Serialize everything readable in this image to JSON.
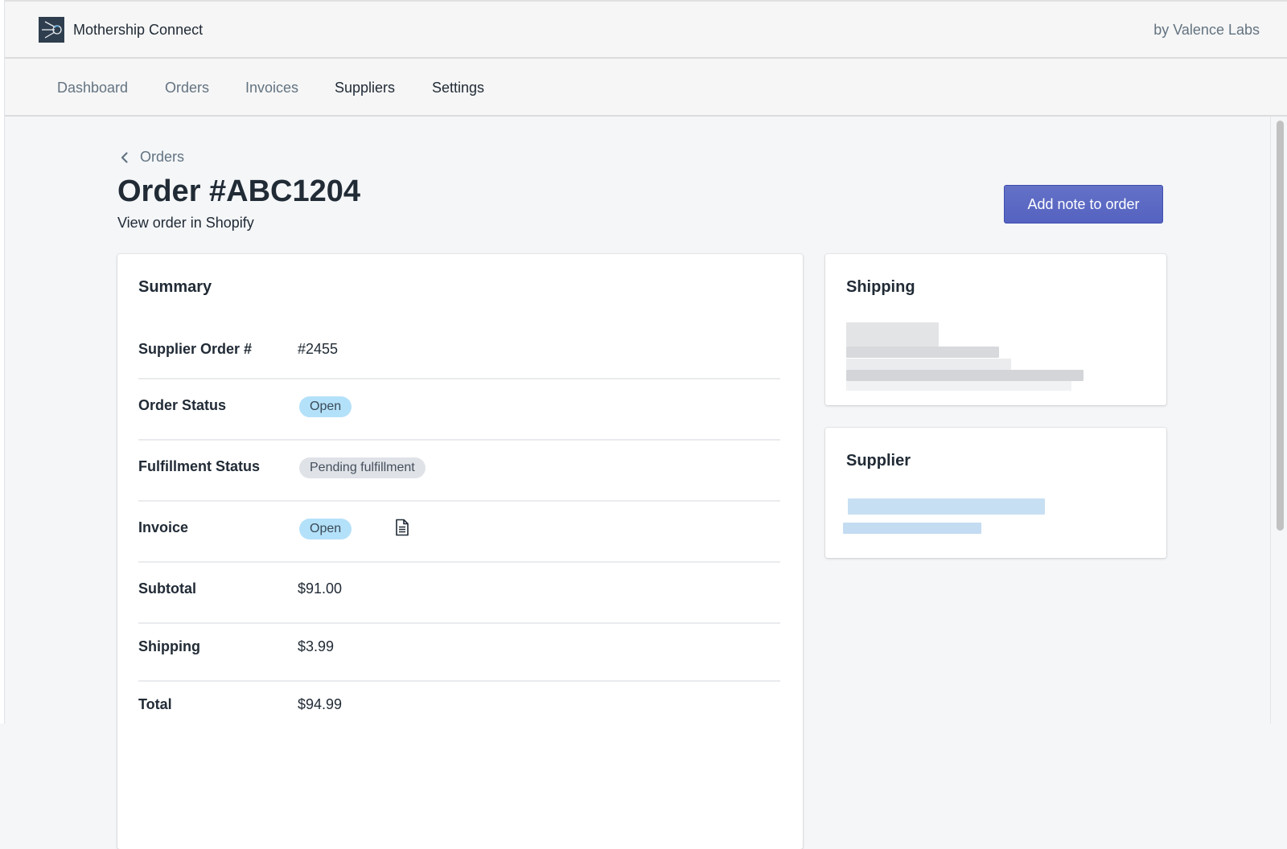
{
  "app": {
    "title": "Mothership Connect",
    "byline": "by Valence Labs",
    "logo_icon": "satellite-logo-icon"
  },
  "nav": {
    "items": [
      {
        "label": "Dashboard"
      },
      {
        "label": "Orders"
      },
      {
        "label": "Invoices"
      },
      {
        "label": "Suppliers"
      },
      {
        "label": "Settings"
      }
    ]
  },
  "page": {
    "breadcrumb": "Orders",
    "title": "Order #ABC1204",
    "shopify_link": "View order in Shopify",
    "add_note_button": "Add note to order"
  },
  "summary": {
    "heading": "Summary",
    "rows": [
      {
        "label": "Supplier Order #",
        "value": "#2455"
      },
      {
        "label": "Order Status",
        "badge": "Open"
      },
      {
        "label": "Fulfillment Status",
        "badge": "Pending fulfillment"
      },
      {
        "label": "Invoice",
        "badge": "Open"
      },
      {
        "label": "Subtotal",
        "value": "$91.00"
      },
      {
        "label": "Shipping",
        "value": "$3.99"
      },
      {
        "label": "Total",
        "value": "$94.99"
      }
    ]
  },
  "shipping": {
    "heading": "Shipping",
    "address": "[redacted]"
  },
  "supplier": {
    "heading": "Supplier",
    "details": "[redacted]"
  },
  "colors": {
    "primary": "#5c6ac4",
    "badge_info": "#b4e1fa",
    "badge_default": "#dfe3e8",
    "text": "#212b36",
    "subdued": "#637381"
  }
}
